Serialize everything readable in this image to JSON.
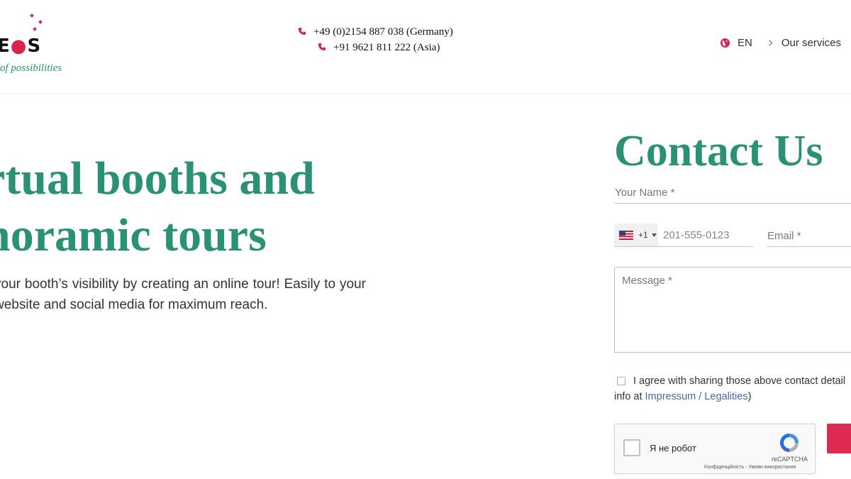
{
  "header": {
    "logo_text_part1": "E",
    "logo_text_part2": "S",
    "tagline": "of possibilities",
    "phones": [
      {
        "number": "+49 (0)2154 887 038 (Germany)",
        "icon": "phone-icon"
      },
      {
        "number": "+91 9621 811 222 (Asia)",
        "icon": "phone-icon"
      }
    ],
    "language": {
      "label": "EN",
      "icon": "globe-icon"
    },
    "services_link": {
      "label": "Our services",
      "icon": "chevron-right-icon"
    }
  },
  "hero": {
    "title_line1": "rtual booths and",
    "title_line2": "noramic tours",
    "description": "your booth’s visibility by creating an online tour! Easily to your website and social media for maximum reach."
  },
  "contact": {
    "title": "Contact Us",
    "name_placeholder": "Your Name *",
    "phone_country_code": "+1",
    "phone_placeholder": "201-555-0123",
    "email_placeholder": "Email *",
    "message_placeholder": "Message *",
    "consent_line1": "I agree with sharing those above contact detail",
    "consent_line2_prefix": "info at ",
    "consent_link": "Impressum / Legalities",
    "consent_line2_suffix": ")",
    "captcha": {
      "label": "Я не робот",
      "brand": "reCAPTCHA",
      "links": "Конфіденційність - Умови використання"
    }
  },
  "colors": {
    "brand_green": "#2a9273",
    "accent_red": "#de2b51",
    "link_blue": "#4a6a9e"
  }
}
